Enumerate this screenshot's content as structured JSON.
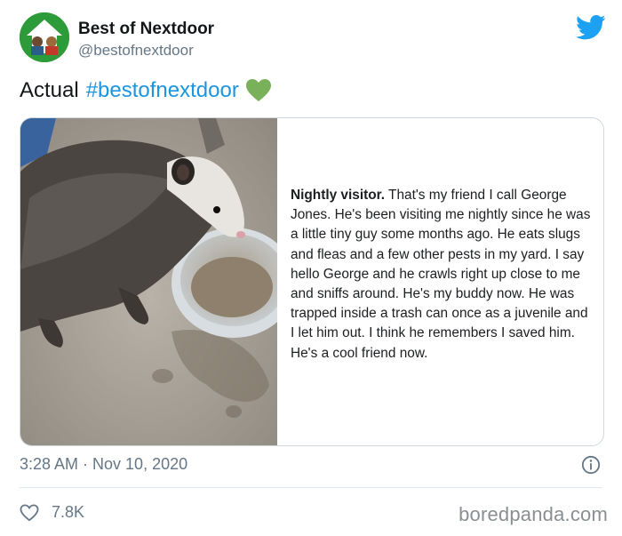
{
  "author": {
    "name": "Best of Nextdoor",
    "handle": "@bestofnextdoor"
  },
  "tweet": {
    "text": "Actual",
    "hashtag": "#bestofnextdoor",
    "emoji": "green-heart"
  },
  "embedded_post": {
    "bold_lead": "Nightly visitor.",
    "body": " That's my friend I call George Jones. He's been visiting me nightly since he was a little tiny guy some months ago. He eats slugs and fleas and a few other pests in my yard. I say hello George and he crawls right up close to me and sniffs around. He's my buddy now. He was trapped inside a trash can once as a juvenile and I let him out. I think he remembers I saved him. He's a cool friend now.",
    "image": "opossum-eating-from-bowl"
  },
  "meta": {
    "timestamp": "3:28 AM · Nov 10, 2020",
    "likes": "7.8K"
  },
  "watermark": "boredpanda.com",
  "colors": {
    "link": "#1b95e0",
    "twitter_blue": "#1da1f2",
    "muted": "#657786",
    "avatar_green": "#2e9b3a",
    "heart_green": "#78b159"
  }
}
